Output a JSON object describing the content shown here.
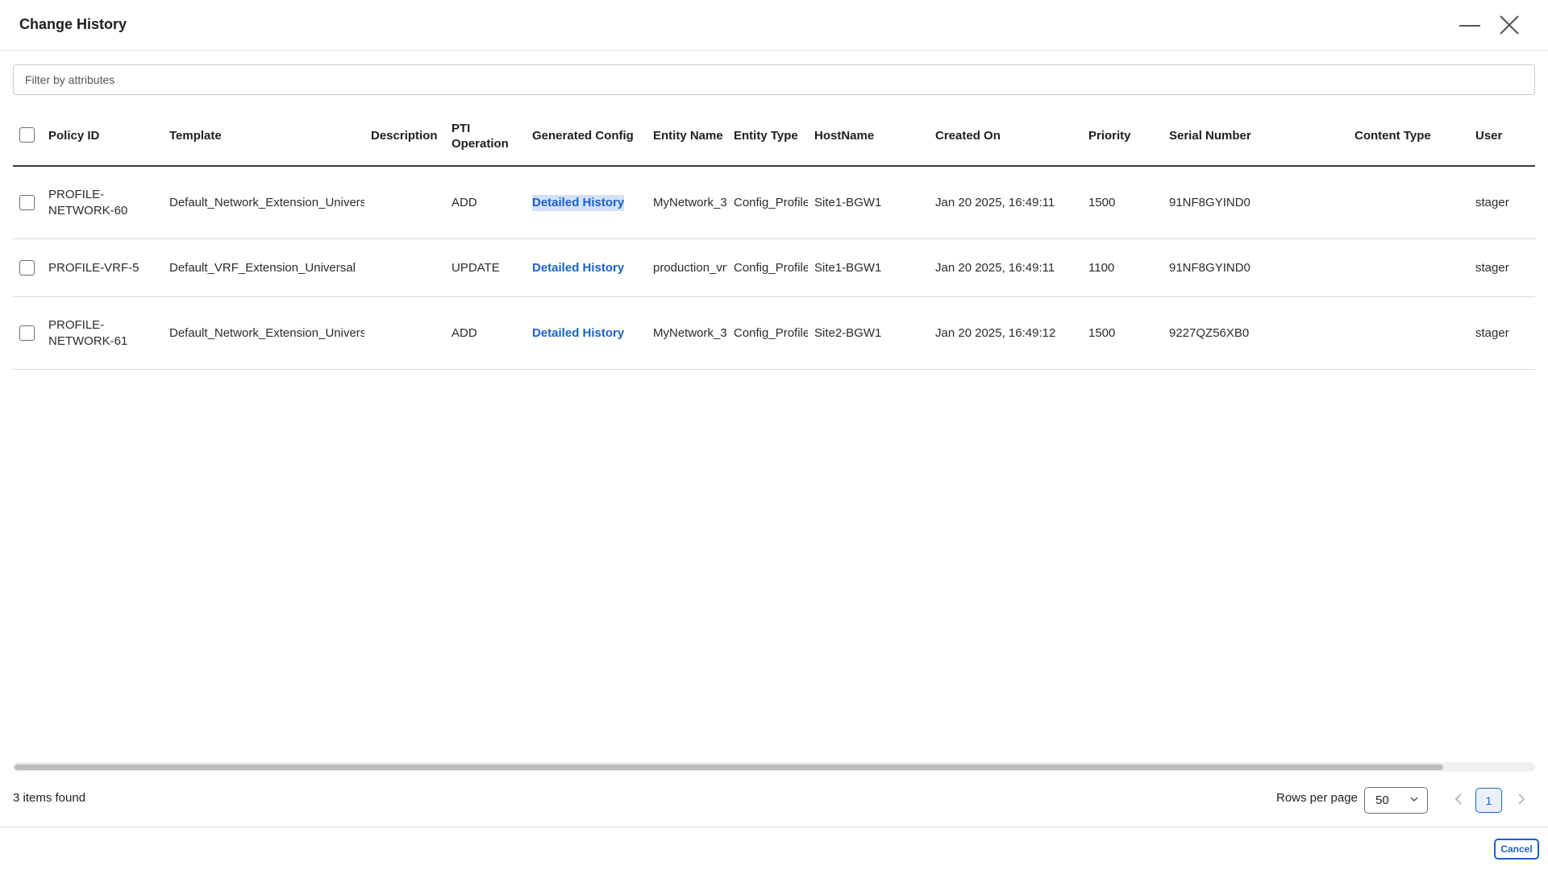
{
  "dialog": {
    "title": "Change History"
  },
  "filter": {
    "placeholder": "Filter by attributes"
  },
  "table": {
    "columns": {
      "policy_id": "Policy ID",
      "template": "Template",
      "description": "Description",
      "pti_operation": "PTI Operation",
      "generated_config": "Generated Config",
      "entity_name": "Entity Name",
      "entity_type": "Entity Type",
      "hostname": "HostName",
      "created_on": "Created On",
      "priority": "Priority",
      "serial_number": "Serial Number",
      "content_type": "Content Type",
      "user": "User"
    },
    "rows": [
      {
        "policy_id": "PROFILE-NETWORK-60",
        "template": "Default_Network_Extension_Universal",
        "description": "",
        "pti_operation": "ADD",
        "generated_config": "Detailed History",
        "entity_name": "MyNetwork_3",
        "entity_type": "Config_Profile",
        "hostname": "Site1-BGW1",
        "created_on": "Jan 20 2025, 16:49:11",
        "priority": "1500",
        "serial_number": "91NF8GYIND0",
        "content_type": "",
        "user": "stager"
      },
      {
        "policy_id": "PROFILE-VRF-5",
        "template": "Default_VRF_Extension_Universal",
        "description": "",
        "pti_operation": "UPDATE",
        "generated_config": "Detailed History",
        "entity_name": "production_vrf",
        "entity_type": "Config_Profile",
        "hostname": "Site1-BGW1",
        "created_on": "Jan 20 2025, 16:49:11",
        "priority": "1100",
        "serial_number": "91NF8GYIND0",
        "content_type": "",
        "user": "stager"
      },
      {
        "policy_id": "PROFILE-NETWORK-61",
        "template": "Default_Network_Extension_Universal",
        "description": "",
        "pti_operation": "ADD",
        "generated_config": "Detailed History",
        "entity_name": "MyNetwork_3",
        "entity_type": "Config_Profile",
        "hostname": "Site2-BGW1",
        "created_on": "Jan 20 2025, 16:49:12",
        "priority": "1500",
        "serial_number": "9227QZ56XB0",
        "content_type": "",
        "user": "stager"
      }
    ]
  },
  "footer": {
    "items_found": "3 items found",
    "rows_per_page_label": "Rows per page",
    "rows_per_page_value": "50",
    "current_page": "1",
    "cancel_label": "Cancel"
  },
  "colors": {
    "accent": "#1b62c9",
    "link_highlight": "#d3e1f7"
  },
  "icons": [
    "minimize-icon",
    "close-icon",
    "chevron-down-icon",
    "chevron-left-icon",
    "chevron-right-icon"
  ]
}
